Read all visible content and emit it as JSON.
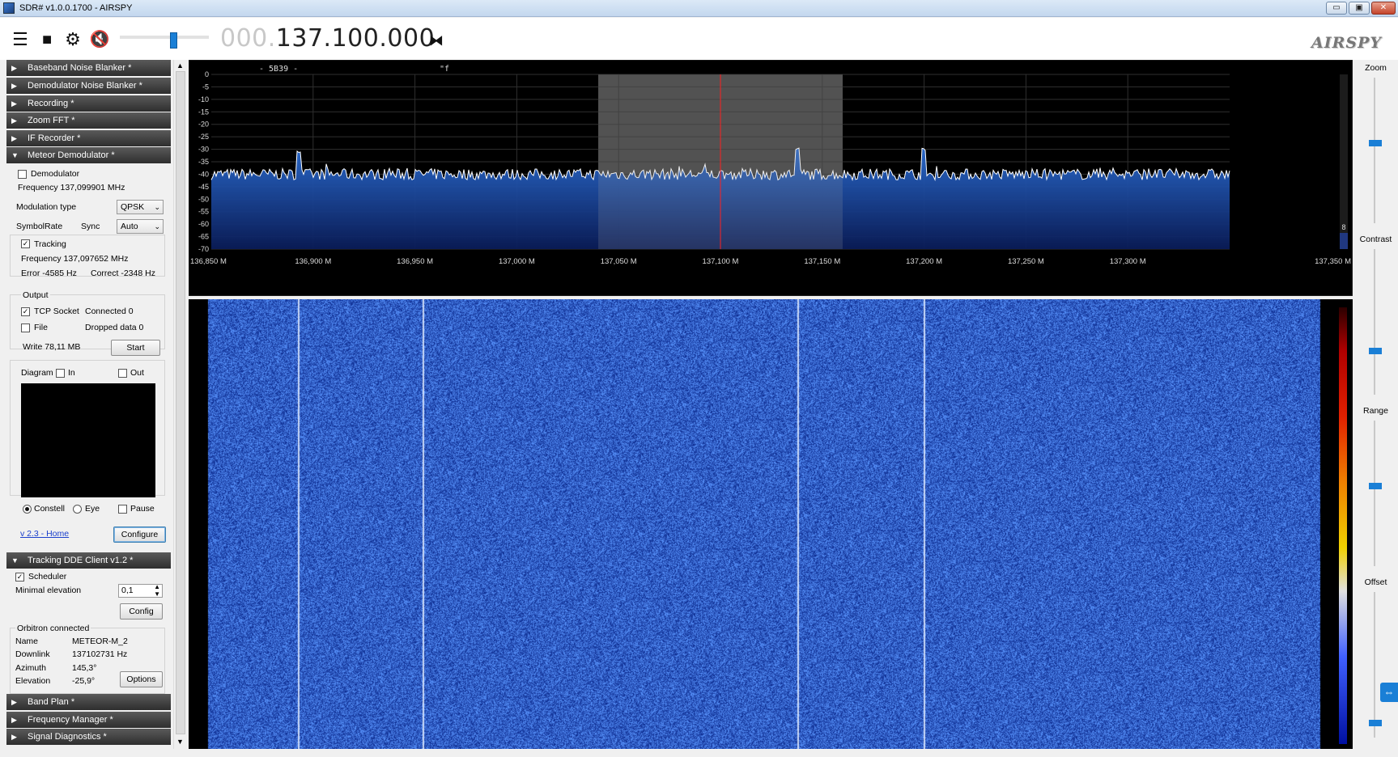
{
  "window": {
    "title": "SDR# v1.0.0.1700 - AIRSPY",
    "buttons": {
      "minimize": "▭",
      "restore": "▣",
      "close": "✕"
    }
  },
  "toolbar": {
    "freq_lead": "000.",
    "freq_main": "137.100.000",
    "logo": "AIRSPY",
    "volume_level": 0.6,
    "icons": [
      "menu-icon",
      "stop-icon",
      "gear-icon",
      "mute-icon",
      "tune-icon"
    ]
  },
  "sidebar": {
    "headers_top": [
      {
        "label": "Baseband Noise Blanker *",
        "expanded": false
      },
      {
        "label": "Demodulator Noise Blanker *",
        "expanded": false
      },
      {
        "label": "Recording *",
        "expanded": false
      },
      {
        "label": "Zoom FFT *",
        "expanded": false
      },
      {
        "label": "IF Recorder *",
        "expanded": false
      },
      {
        "label": "Meteor Demodulator *",
        "expanded": true
      }
    ],
    "meteor": {
      "demodulator_label": "Demodulator",
      "frequency": "Frequency 137,099901 MHz",
      "modulation_label": "Modulation type",
      "modulation_value": "QPSK",
      "symbolrate_label": "SymbolRate",
      "sync_label": "Sync",
      "sync_value": "Auto",
      "tracking_label": "Tracking",
      "tracking_freq": "Frequency 137,097652 MHz",
      "error": "Error -4585 Hz",
      "correct": "Correct -2348 Hz",
      "output_label": "Output",
      "tcp_label": "TCP Socket",
      "connected": "Connected 0",
      "file_label": "File",
      "dropped": "Dropped data 0",
      "write": "Write 78,11 MB",
      "start_button": "Start",
      "diagram_label": "Diagram",
      "in_label": "In",
      "out_label": "Out",
      "constell_label": "Constell",
      "eye_label": "Eye",
      "pause_label": "Pause",
      "home_link": "v 2.3 - Home",
      "configure_button": "Configure"
    },
    "tracking_header": "Tracking DDE Client v1.2 *",
    "tracking": {
      "scheduler_label": "Scheduler",
      "min_elev_label": "Minimal elevation",
      "min_elev_value": "0,1",
      "config_button": "Config",
      "orbitron_label": "Orbitron connected",
      "rows": [
        {
          "k": "Name",
          "v": "METEOR-M_2"
        },
        {
          "k": "Downlink",
          "v": "137102731 Hz"
        },
        {
          "k": "Azimuth",
          "v": "145,3°"
        },
        {
          "k": "Elevation",
          "v": "-25,9°"
        }
      ],
      "options_button": "Options"
    },
    "headers_bottom": [
      {
        "label": "Band Plan *"
      },
      {
        "label": "Frequency Manager *"
      },
      {
        "label": "Signal Diagnostics *"
      }
    ]
  },
  "spectrum": {
    "overlay_left": "- 5B39 -",
    "overlay_right": "\"f",
    "y_ticks": [
      "0",
      "-5",
      "-10",
      "-15",
      "-20",
      "-25",
      "-30",
      "-35",
      "-40",
      "-45",
      "-50",
      "-55",
      "-60",
      "-65",
      "-70"
    ],
    "x_ticks": [
      "136,850 M",
      "136,900 M",
      "136,950 M",
      "137,000 M",
      "137,050 M",
      "137,100 M",
      "137,150 M",
      "137,200 M",
      "137,250 M",
      "137,300 M",
      "137,350 M"
    ],
    "x_range": [
      136.85,
      137.35
    ],
    "y_range": [
      -70,
      0
    ],
    "passband": [
      137.04,
      137.16
    ],
    "center": 137.1,
    "noise_floor": -40,
    "peaks": [
      {
        "f": 136.893,
        "db": -31
      },
      {
        "f": 137.138,
        "db": -30
      },
      {
        "f": 137.2,
        "db": -30
      }
    ],
    "side_value": "8",
    "colors": {
      "fill_top": "#2a6bd0",
      "fill_bottom": "#0a1c58",
      "passband": "#5a5a5a",
      "center_line": "#ff2020",
      "trace": "#ffffff"
    }
  },
  "waterfall": {
    "signal_lines": [
      136.893,
      136.954,
      137.138,
      137.2
    ]
  },
  "rightbar": {
    "labels": [
      "Zoom",
      "Contrast",
      "Range",
      "Offset"
    ],
    "levels": [
      0.55,
      0.3,
      0.55,
      0.1
    ]
  }
}
